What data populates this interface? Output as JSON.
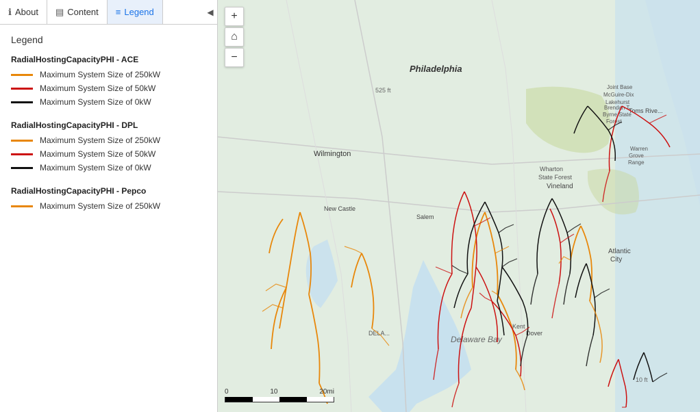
{
  "tabs": [
    {
      "id": "about",
      "label": "About",
      "icon": "ℹ",
      "active": false
    },
    {
      "id": "content",
      "label": "Content",
      "icon": "▤",
      "active": false
    },
    {
      "id": "legend",
      "label": "Legend",
      "icon": "≡",
      "active": true
    }
  ],
  "legend": {
    "title": "Legend",
    "sections": [
      {
        "title": "RadialHostingCapacityPHI - ACE",
        "items": [
          {
            "color": "#e8870a",
            "label": "Maximum System Size of 250kW"
          },
          {
            "color": "#cc1111",
            "label": "Maximum System Size of 50kW"
          },
          {
            "color": "#111111",
            "label": "Maximum System Size of 0kW"
          }
        ]
      },
      {
        "title": "RadialHostingCapacityPHI - DPL",
        "items": [
          {
            "color": "#e8870a",
            "label": "Maximum System Size of 250kW"
          },
          {
            "color": "#cc1111",
            "label": "Maximum System Size of 50kW"
          },
          {
            "color": "#111111",
            "label": "Maximum System Size of 0kW"
          }
        ]
      },
      {
        "title": "RadialHostingCapacityPHI - Pepco",
        "items": [
          {
            "color": "#e8870a",
            "label": "Maximum System Size of 250kW"
          }
        ]
      }
    ]
  },
  "map_controls": {
    "zoom_in": "+",
    "home": "⌂",
    "zoom_out": "−"
  },
  "scale": {
    "labels": [
      "0",
      "10",
      "20mi"
    ]
  }
}
